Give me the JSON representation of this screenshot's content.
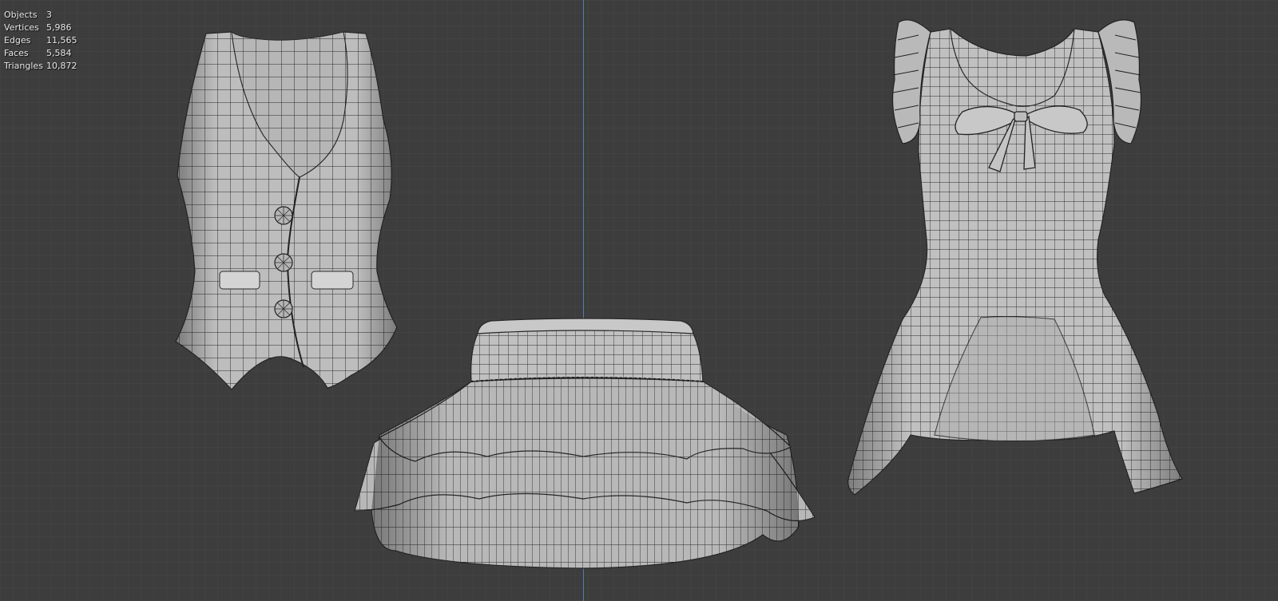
{
  "viewport": {
    "background": "#3d3d3d",
    "grid_color": "#474747",
    "axis_color": "#4f7db3"
  },
  "stats": {
    "rows": [
      {
        "label": "Objects",
        "value": "3"
      },
      {
        "label": "Vertices",
        "value": "5,986"
      },
      {
        "label": "Edges",
        "value": "11,565"
      },
      {
        "label": "Faces",
        "value": "5,584"
      },
      {
        "label": "Triangles",
        "value": "10,872"
      }
    ]
  },
  "objects": [
    {
      "name": "vest",
      "buttons": 3
    },
    {
      "name": "skirt",
      "tiers": 3
    },
    {
      "name": "top",
      "has_bow": true,
      "ruffle_sleeves": 2
    }
  ],
  "mesh": {
    "surface_color": "#bdbdbd",
    "wire_color": "#242424"
  }
}
